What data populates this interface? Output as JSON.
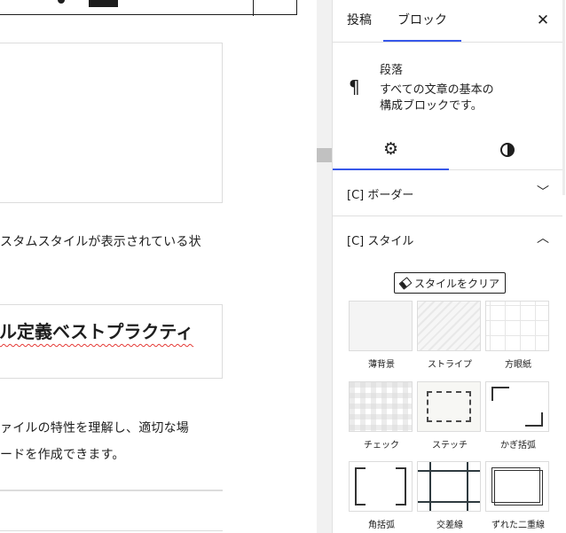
{
  "editor": {
    "paragraph_1": "スタムスタイルが表示されている状",
    "heading": "ル定義ベストプラクティ",
    "paragraph_2": "ァイルの特性を理解し、適切な場",
    "paragraph_3": "ードを作成できます。"
  },
  "sidebar": {
    "tabs": [
      {
        "label": "投稿",
        "active": false
      },
      {
        "label": "ブロック",
        "active": true
      }
    ],
    "close_icon": "close-icon",
    "block": {
      "icon": "paragraph-icon",
      "title": "段落",
      "description_line1": "すべての文章の基本の",
      "description_line2": "構成ブロックです。"
    },
    "panel_tabs": [
      {
        "icon": "gear-icon",
        "active": true
      },
      {
        "icon": "styles-half-circle-icon",
        "active": false
      }
    ],
    "sections": [
      {
        "label": "[C] ボーダー",
        "expanded": false
      },
      {
        "label": "[C] スタイル",
        "expanded": true
      }
    ],
    "clear_button": "スタイルをクリア",
    "styles": [
      {
        "name": "薄背景"
      },
      {
        "name": "ストライプ"
      },
      {
        "name": "方眼紙"
      },
      {
        "name": "チェック"
      },
      {
        "name": "ステッチ"
      },
      {
        "name": "かぎ括弧"
      },
      {
        "name": "角括弧"
      },
      {
        "name": "交差線"
      },
      {
        "name": "ずれた二重線"
      }
    ],
    "accent_color": "#3858e9"
  }
}
